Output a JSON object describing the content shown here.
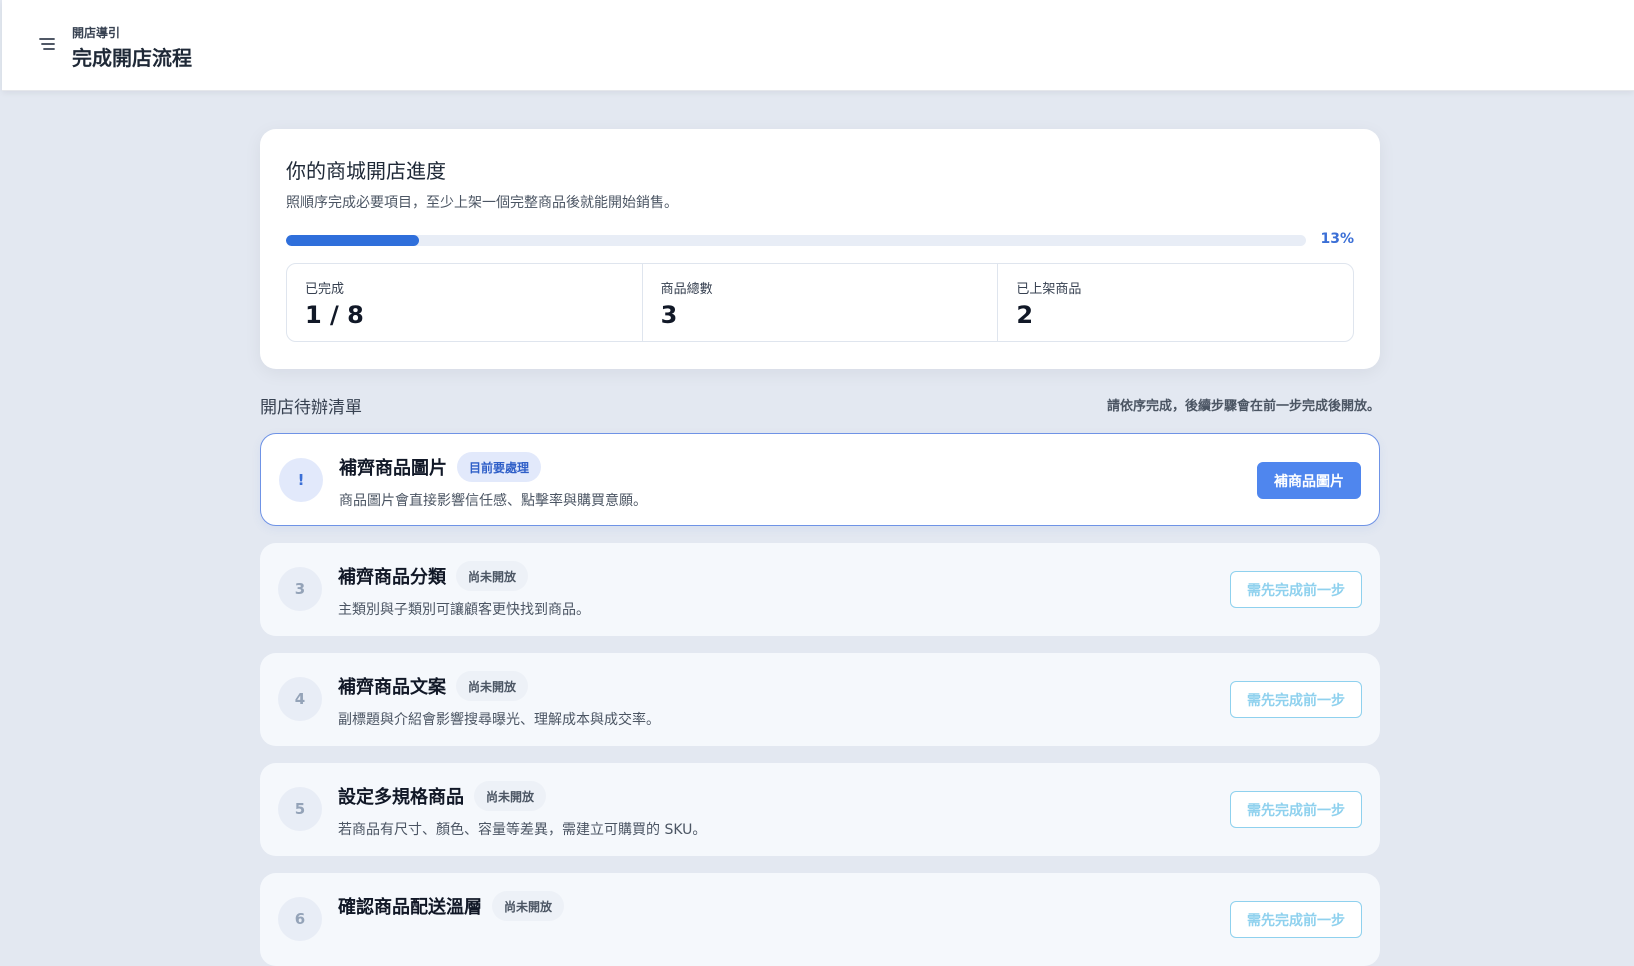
{
  "header": {
    "eyebrow": "開店導引",
    "title": "完成開店流程",
    "menu_icon": "menu-icon"
  },
  "summary": {
    "title": "你的商城開店進度",
    "description": "照順序完成必要項目，至少上架一個完整商品後就能開始銷售。",
    "progress_percent": 13,
    "progress_label": "13%",
    "stats": [
      {
        "label": "已完成",
        "value": "1 / 8"
      },
      {
        "label": "商品總數",
        "value": "3"
      },
      {
        "label": "已上架商品",
        "value": "2"
      }
    ]
  },
  "todo": {
    "title": "開店待辦清單",
    "hint": "請依序完成，後續步驟會在前一步完成後開放。",
    "tasks": [
      {
        "marker": "!",
        "title": "補齊商品圖片",
        "badge": "目前要處理",
        "description": "商品圖片會直接影響信任感、點擊率與購買意願。",
        "button": "補商品圖片",
        "state": "active"
      },
      {
        "marker": "3",
        "title": "補齊商品分類",
        "badge": "尚未開放",
        "description": "主類別與子類別可讓顧客更快找到商品。",
        "button": "需先完成前一步",
        "state": "locked"
      },
      {
        "marker": "4",
        "title": "補齊商品文案",
        "badge": "尚未開放",
        "description": "副標題與介紹會影響搜尋曝光、理解成本與成交率。",
        "button": "需先完成前一步",
        "state": "locked"
      },
      {
        "marker": "5",
        "title": "設定多規格商品",
        "badge": "尚未開放",
        "description": "若商品有尺寸、顏色、容量等差異，需建立可購買的 SKU。",
        "button": "需先完成前一步",
        "state": "locked"
      },
      {
        "marker": "6",
        "title": "確認商品配送溫層",
        "badge": "尚未開放",
        "description": "",
        "button": "需先完成前一步",
        "state": "locked"
      }
    ]
  },
  "colors": {
    "accent": "#4f86ee",
    "progress": "#2f6fdb",
    "locked_button": "#8fd1ee",
    "page_bg": "#e3e8f1"
  }
}
